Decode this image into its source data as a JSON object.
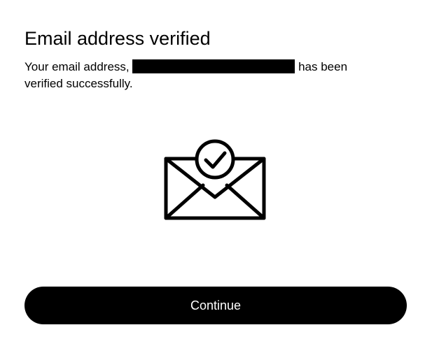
{
  "dialog": {
    "title": "Email address verified",
    "message_before": "Your email address,",
    "message_after": "has been verified successfully.",
    "continue_label": "Continue"
  },
  "icons": {
    "illustration": "envelope-checkmark-icon"
  },
  "colors": {
    "button_background": "#000000",
    "button_text": "#ffffff",
    "text": "#000000",
    "background": "#ffffff"
  }
}
